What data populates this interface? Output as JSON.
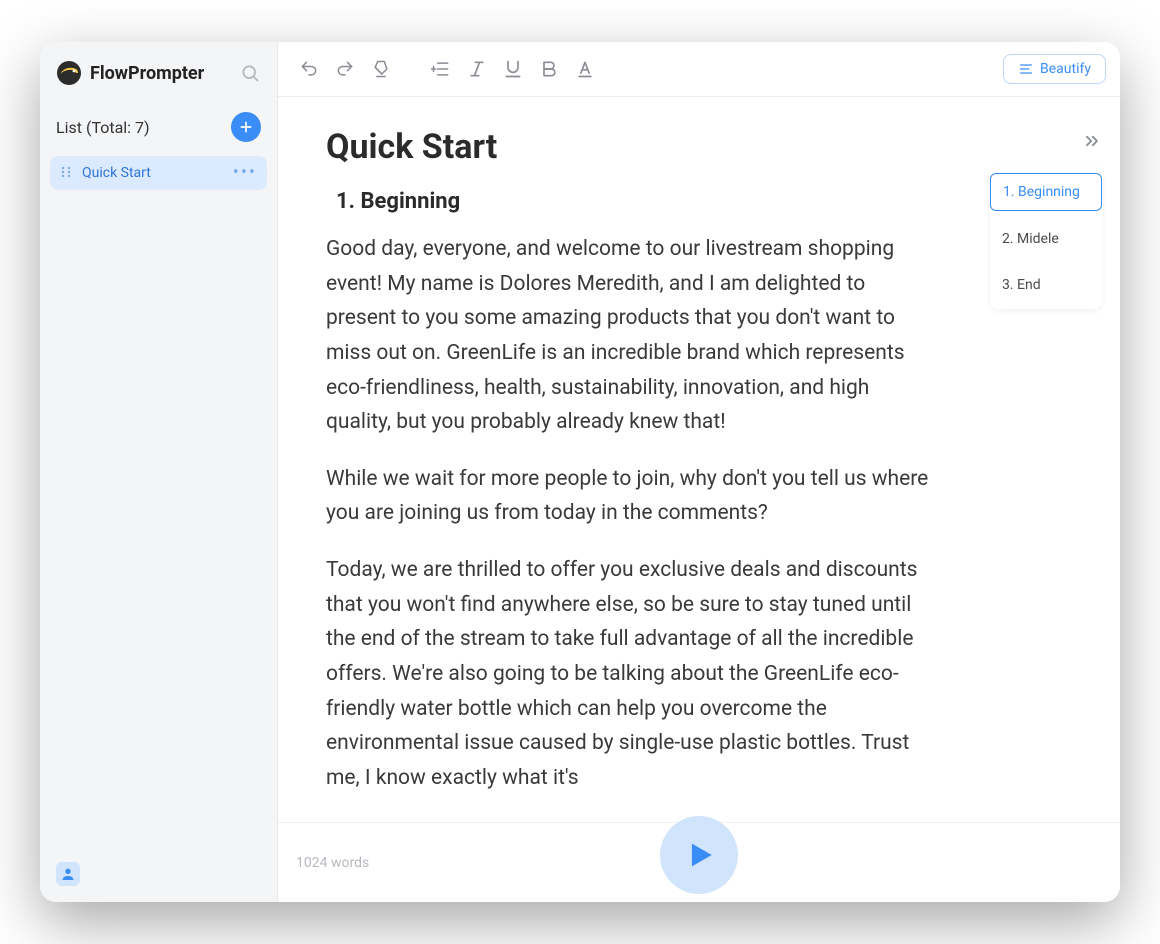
{
  "brand": "FlowPrompter",
  "sidebar": {
    "list_label": "List (Total: 7)",
    "items": [
      {
        "label": "Quick Start",
        "active": true
      }
    ]
  },
  "toolbar": {
    "beautify_label": "Beautify"
  },
  "document": {
    "title": "Quick Start",
    "sections": [
      {
        "heading": "1. Beginning",
        "paragraphs": [
          "Good day, everyone, and welcome to our livestream shopping event! My name is Dolores Meredith, and I am delighted to present to you some amazing products that you don't want to miss out on. GreenLife is an incredible brand which represents eco-friendliness, health, sustainability, innovation, and high quality, but you probably already knew that!",
          "While we wait for more people to join, why don't you tell us where you are joining us from today in the comments?",
          "Today, we are thrilled to offer you exclusive deals and discounts that you won't find anywhere else, so be sure to stay tuned until the end of the stream to take full advantage of all the incredible offers. We're also going to be talking about the GreenLife eco-friendly water bottle which can help you overcome the environmental issue caused by single-use plastic bottles. Trust me, I know exactly what it's"
        ]
      }
    ]
  },
  "outline": [
    {
      "label": "1. Beginning",
      "active": true
    },
    {
      "label": "2. Midele",
      "active": false
    },
    {
      "label": "3. End",
      "active": false
    }
  ],
  "status": {
    "word_count_label": "1024 words"
  }
}
